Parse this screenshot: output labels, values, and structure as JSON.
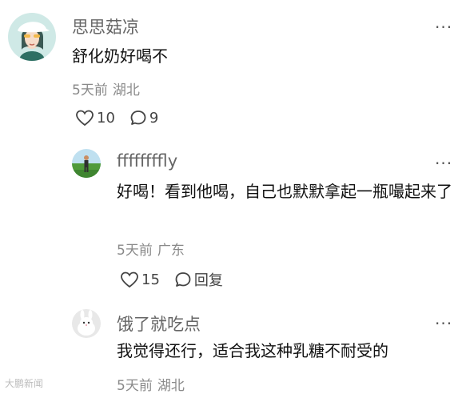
{
  "comments": [
    {
      "username": "思思菇凉",
      "text": "舒化奶好喝不",
      "date": "5天前",
      "location": "湖北",
      "likes": "10",
      "replies": "9",
      "more": "···"
    },
    {
      "username": "ffffffffly",
      "text": "好喝！看到他喝，自己也默默拿起一瓶嘬起来了",
      "date": "5天前",
      "location": "广东",
      "likes": "15",
      "reply_label": "回复",
      "more": "···"
    },
    {
      "username": "饿了就吃点",
      "text": "我觉得还行，适合我这种乳糖不耐受的",
      "date": "5天前",
      "location": "湖北",
      "more": "···"
    }
  ],
  "watermark": "大鹏新闻",
  "icons": {
    "like": "heart-outline-icon",
    "comment": "comment-bubble-icon",
    "more": "more-dots-icon"
  }
}
